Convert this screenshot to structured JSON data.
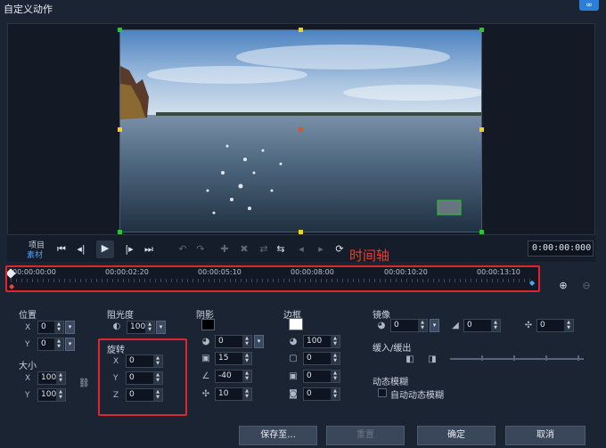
{
  "window": {
    "title": "自定义动作",
    "corner_icon": "link-icon"
  },
  "transport": {
    "project_label": "项目",
    "clip_label": "素材",
    "timecode": "0:00:00:000"
  },
  "timeline": {
    "ticks": [
      "00:00:00:00",
      "00:00:02:20",
      "00:00:05:10",
      "00:00:08:00",
      "00:00:10:20",
      "00:00:13:10"
    ],
    "annotation": "时间轴"
  },
  "position": {
    "label": "位置",
    "x_axis": "X",
    "x": "0",
    "y_axis": "Y",
    "y": "0"
  },
  "size": {
    "label": "大小",
    "x_axis": "X",
    "x": "100",
    "y_axis": "Y",
    "y": "100"
  },
  "opacity": {
    "label": "阻光度",
    "value": "100"
  },
  "rotation": {
    "label": "旋转",
    "x_axis": "X",
    "x": "0",
    "y_axis": "Y",
    "y": "0",
    "z_axis": "Z",
    "z": "0"
  },
  "shadow": {
    "label": "阴影",
    "v1": "0",
    "v2": "15",
    "v3": "-40",
    "v4": "10"
  },
  "border": {
    "label": "边框",
    "v1": "100",
    "v2": "0",
    "v3": "0",
    "v4": "0"
  },
  "mirror": {
    "label": "镜像",
    "v1": "0",
    "v2": "0",
    "v3": "0"
  },
  "fade": {
    "label": "缓入/缓出"
  },
  "motion_blur": {
    "label": "动态模糊",
    "checkbox_label": "自动动态模糊"
  },
  "buttons": {
    "save_as": "保存至...",
    "reset": "重置",
    "ok": "确定",
    "cancel": "取消"
  },
  "colors": {
    "accent": "#2b7fd8",
    "highlight": "#e0262c",
    "handle": "#28c828"
  }
}
